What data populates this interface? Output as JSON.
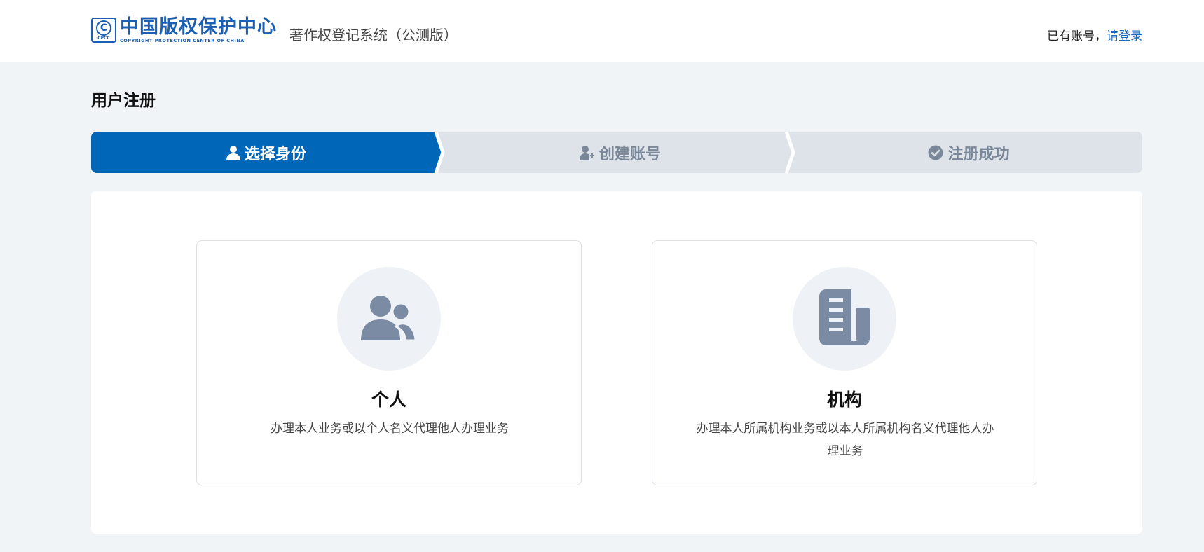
{
  "header": {
    "logo_cn": "中国版权保护中心",
    "logo_en": "COPYRIGHT PROTECTION CENTER OF CHINA",
    "logo_mark_symbol": "C",
    "logo_mark_sub": "CPCC",
    "system_name": "著作权登记系统（公测版）",
    "login_prompt": "已有账号，",
    "login_link": "请登录"
  },
  "page": {
    "title": "用户注册"
  },
  "steps": [
    {
      "label": "选择身份",
      "icon": "user-icon",
      "active": true
    },
    {
      "label": "创建账号",
      "icon": "user-add-icon",
      "active": false
    },
    {
      "label": "注册成功",
      "icon": "check-circle-icon",
      "active": false
    }
  ],
  "cards": {
    "individual": {
      "title": "个人",
      "description": "办理本人业务或以个人名义代理他人办理业务",
      "icon": "users-icon"
    },
    "organization": {
      "title": "机构",
      "description": "办理本人所属机构业务或以本人所属机构名义代理他人办理业务",
      "icon": "building-icon"
    }
  },
  "colors": {
    "primary": "#0066b8",
    "inactive_step_bg": "#dee3ea",
    "inactive_step_text": "#7a8799",
    "icon_gray": "#7a8ba3",
    "page_bg": "#f1f4f7"
  }
}
